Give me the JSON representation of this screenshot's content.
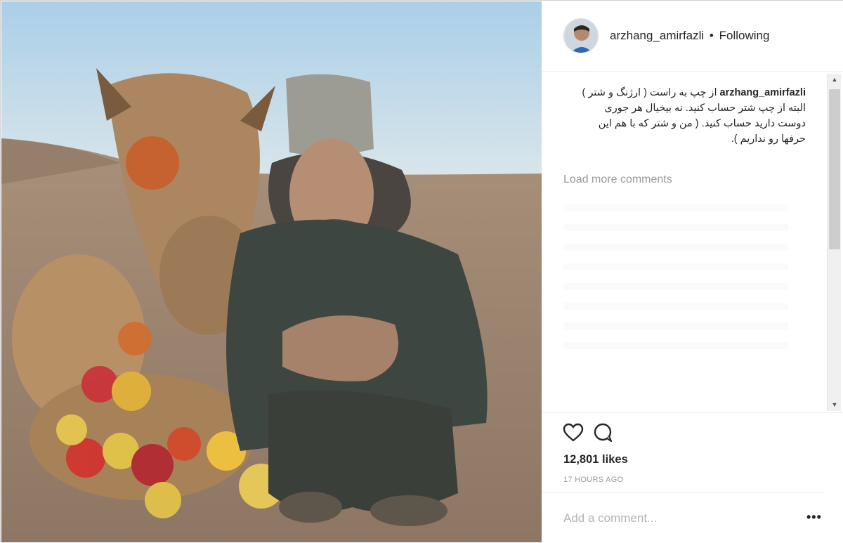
{
  "post": {
    "username": "arzhang_amirfazli",
    "separator": "•",
    "follow_status": "Following",
    "caption_user": "arzhang_amirfazli",
    "caption_text": "از چپ به راست ( ارژنگ و شتر ) البته از چپ شتر حساب کنید. نه بیخیال هر جوری دوست دارید حساب کنید. ( من و شتر که با هم این حرفها رو نداریم ).",
    "load_more_label": "Load more comments",
    "likes_text": "12,801 likes",
    "timestamp": "17 HOURS AGO",
    "comment_placeholder": "Add a comment...",
    "more_label": "•••"
  },
  "icons": {
    "like": "heart-icon",
    "comment": "comment-icon",
    "scroll_up": "arrow-up-icon",
    "scroll_down": "arrow-down-icon"
  },
  "colors": {
    "text": "#262626",
    "muted": "#999999",
    "border": "#efefef"
  }
}
